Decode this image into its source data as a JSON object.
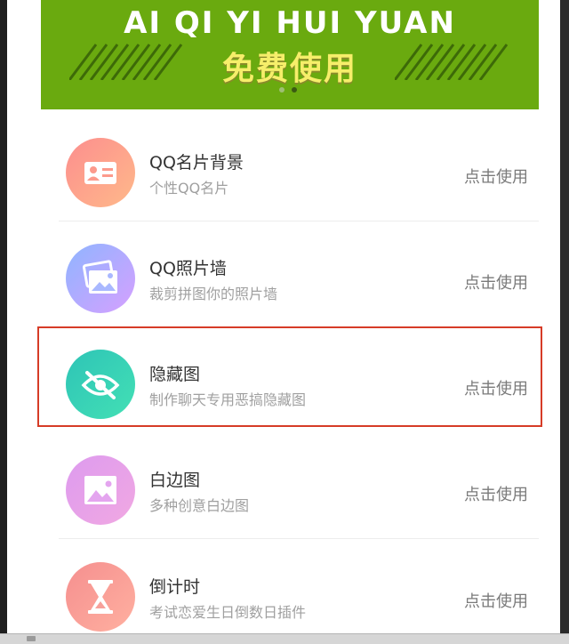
{
  "banner": {
    "title": "AI QI YI HUI YUAN",
    "cta": "免费使用",
    "bg_color": "#6aaa0f",
    "cta_color": "#f6ee6a",
    "carousel_active_index": 1,
    "carousel_count": 2
  },
  "items": [
    {
      "title": "QQ名片背景",
      "subtitle": "个性QQ名片",
      "action": "点击使用",
      "icon": "id-card-icon",
      "gradient": [
        "#fc8e8e",
        "#ffb98a"
      ]
    },
    {
      "title": "QQ照片墙",
      "subtitle": "裁剪拼图你的照片墙",
      "action": "点击使用",
      "icon": "photos-icon",
      "gradient": [
        "#8fb5ff",
        "#d6a0ff"
      ]
    },
    {
      "title": "隐藏图",
      "subtitle": "制作聊天专用恶搞隐藏图",
      "action": "点击使用",
      "icon": "eye-off-icon",
      "gradient": [
        "#2ec4b6",
        "#43e0b5"
      ],
      "highlighted": true
    },
    {
      "title": "白边图",
      "subtitle": "多种创意白边图",
      "action": "点击使用",
      "icon": "picture-icon",
      "gradient": [
        "#dd9bef",
        "#f1a8e2"
      ]
    },
    {
      "title": "倒计时",
      "subtitle": "考试恋爱生日倒数日插件",
      "action": "点击使用",
      "icon": "hourglass-icon",
      "gradient": [
        "#f58f8f",
        "#ffb0a0"
      ]
    }
  ],
  "highlight_color": "#d63c27"
}
